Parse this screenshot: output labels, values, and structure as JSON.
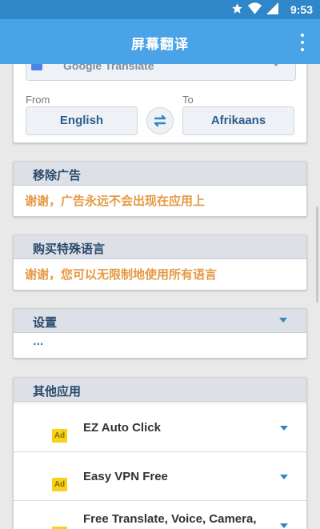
{
  "status": {
    "time": "9:53"
  },
  "appbar": {
    "title": "屏幕翻译"
  },
  "translator": {
    "engine": "Google Translate",
    "from_label": "From",
    "to_label": "To",
    "from_lang": "English",
    "to_lang": "Afrikaans"
  },
  "remove_ads": {
    "title": "移除广告",
    "message": "谢谢，广告永远不会出现在应用上"
  },
  "special_langs": {
    "title": "购买特殊语言",
    "message": "谢谢，您可以无限制地使用所有语言"
  },
  "settings": {
    "title": "设置",
    "ellipsis": "..."
  },
  "other_apps": {
    "title": "其他应用",
    "ad_badge": "Ad",
    "apps": [
      {
        "name": "EZ Auto Click"
      },
      {
        "name": "Easy VPN Free"
      },
      {
        "name": "Free Translate, Voice, Camera,"
      }
    ]
  },
  "colors": {
    "appbar": "#4aa3e6",
    "statusbar": "#2f86c9",
    "accent_orange": "#e59a43",
    "header_text": "#2a4a6c"
  }
}
